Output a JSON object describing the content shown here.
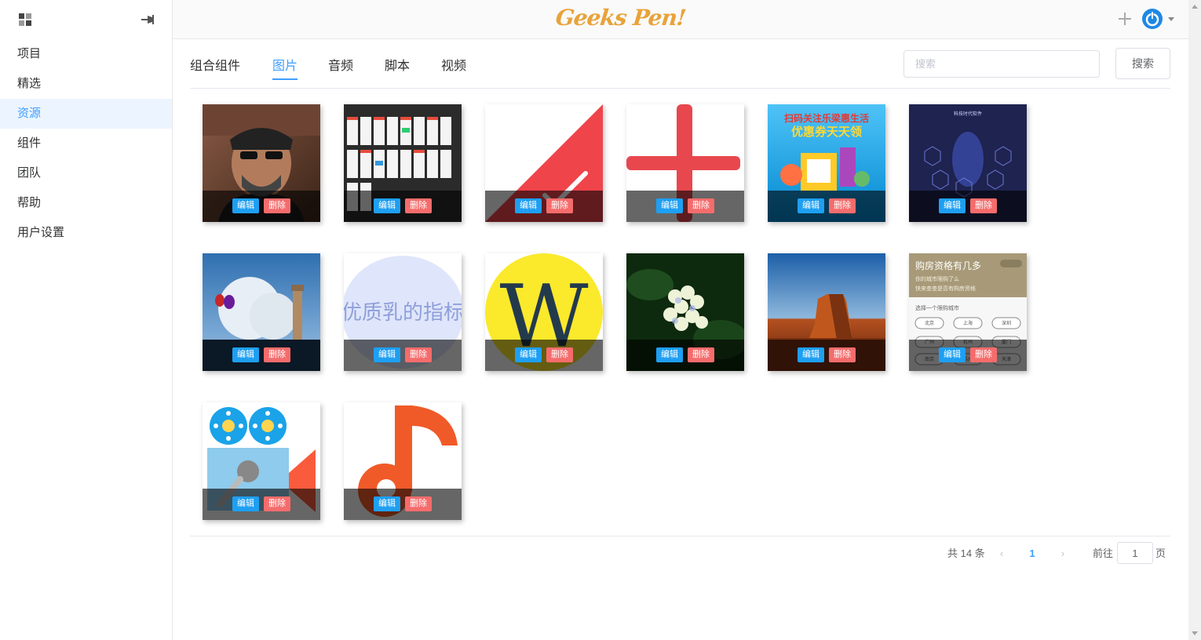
{
  "header": {
    "logo_text": "Geeks Pen!"
  },
  "sidebar": {
    "items": [
      {
        "label": "项目"
      },
      {
        "label": "精选"
      },
      {
        "label": "资源",
        "active": true
      },
      {
        "label": "组件"
      },
      {
        "label": "团队"
      },
      {
        "label": "帮助"
      },
      {
        "label": "用户设置"
      }
    ]
  },
  "tabs": [
    {
      "label": "组合组件"
    },
    {
      "label": "图片",
      "active": true
    },
    {
      "label": "音频"
    },
    {
      "label": "脚本"
    },
    {
      "label": "视频"
    }
  ],
  "search": {
    "placeholder": "搜索",
    "button_label": "搜索"
  },
  "card_actions": {
    "edit": "编辑",
    "delete": "删除"
  },
  "images": [
    {
      "name": "portrait-photo"
    },
    {
      "name": "app-screens-collage"
    },
    {
      "name": "red-corner-graphic"
    },
    {
      "name": "red-cross-graphic"
    },
    {
      "name": "promo-poster",
      "text_line1": "扫码关注乐梁惠生活",
      "text_line2": "优惠券天天领"
    },
    {
      "name": "dark-blue-infographic",
      "text": "科技时代软件"
    },
    {
      "name": "lighthouse-balloons-photo"
    },
    {
      "name": "text-banner",
      "text": "优质乳的指标"
    },
    {
      "name": "letter-w-logo",
      "text": "W"
    },
    {
      "name": "hydrangea-photo"
    },
    {
      "name": "desert-mesa-photo"
    },
    {
      "name": "housing-qualification-card",
      "title": "购房资格有几多",
      "sub1": "你的城市限购了么",
      "sub2": "快来查查是否有购房资格",
      "prompt": "选择一个限购城市",
      "cities": [
        "北京",
        "上海",
        "深圳",
        "广州",
        "杭州",
        "厦门",
        "南京",
        "苏州",
        "天津"
      ]
    },
    {
      "name": "video-camera-icon"
    },
    {
      "name": "music-note-icon"
    }
  ],
  "pagination": {
    "total": "共 14 条",
    "current": "1",
    "goto_label": "前往",
    "goto_value": "1",
    "page_unit": "页"
  },
  "colors": {
    "accent": "#409eff",
    "edit": "#1e9ff2",
    "delete": "#f56c6c",
    "logo": "#e9a33a"
  }
}
